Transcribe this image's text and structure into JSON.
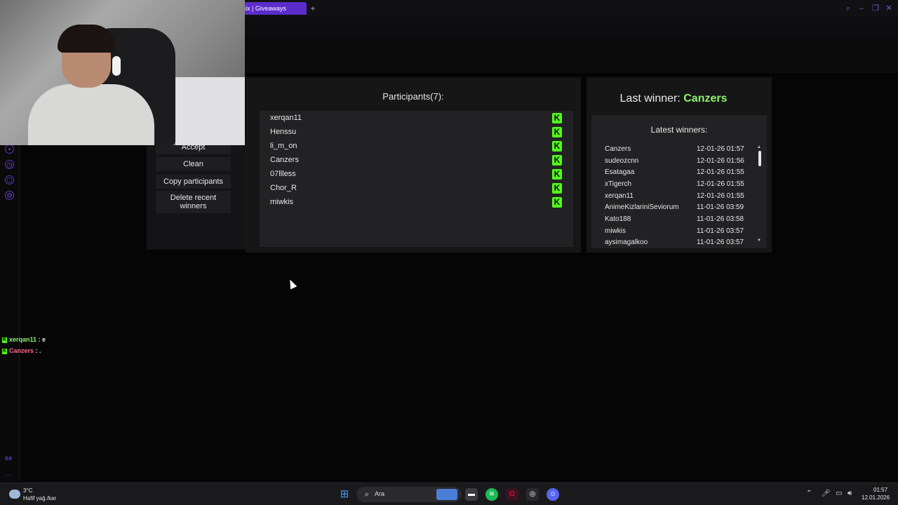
{
  "browser": {
    "active_tab_label": "Bix | Giveaways",
    "new_tab_symbol": "+"
  },
  "left_panel": {
    "buttons": [
      "Accept",
      "Clean",
      "Copy participants",
      "Delete recent winners"
    ]
  },
  "participants": {
    "title": "Participants(7):",
    "items": [
      "xerqan11",
      "Henssu",
      "li_m_on",
      "Canzers",
      "07llless",
      "Chor_R",
      "miwkis"
    ],
    "platform_symbol": "K"
  },
  "winners": {
    "last_winner_label": "Last winner:",
    "last_winner_name": "Canzers",
    "latest_title": "Latest winners:",
    "items": [
      {
        "name": "Canzers",
        "date": "12-01-26 01:57"
      },
      {
        "name": "sudeozcnn",
        "date": "12-01-26 01:56"
      },
      {
        "name": "Esatagaa",
        "date": "12-01-26 01:55"
      },
      {
        "name": "xTigerch",
        "date": "12-01-26 01:55"
      },
      {
        "name": "xerqan11",
        "date": "12-01-26 01:55"
      },
      {
        "name": "AnimeKizlariniSeviorum",
        "date": "11-01-26 03:59"
      },
      {
        "name": "Kato188",
        "date": "11-01-26 03:58"
      },
      {
        "name": "miwkis",
        "date": "11-01-26 03:57"
      },
      {
        "name": "aysimagalkoo",
        "date": "11-01-26 03:57"
      }
    ]
  },
  "chat": {
    "messages": [
      {
        "user": "xerqan11",
        "text": " : e",
        "color": "#8ff36b"
      },
      {
        "user": "Canzers",
        "text": " : .",
        "color": "#ff6b8a"
      }
    ]
  },
  "sidebar": {
    "gx_label": "GX",
    "more_label": "..."
  },
  "taskbar": {
    "weather_temp": "3°C",
    "weather_desc": "Hafif yağ./kar",
    "search_placeholder": "Ara",
    "clock_time": "01:57",
    "clock_date": "12.01.2026"
  },
  "colors": {
    "kick_green": "#53fc18",
    "tab_accent": "#5b2ccb",
    "winner_highlight": "#8ff36b"
  }
}
